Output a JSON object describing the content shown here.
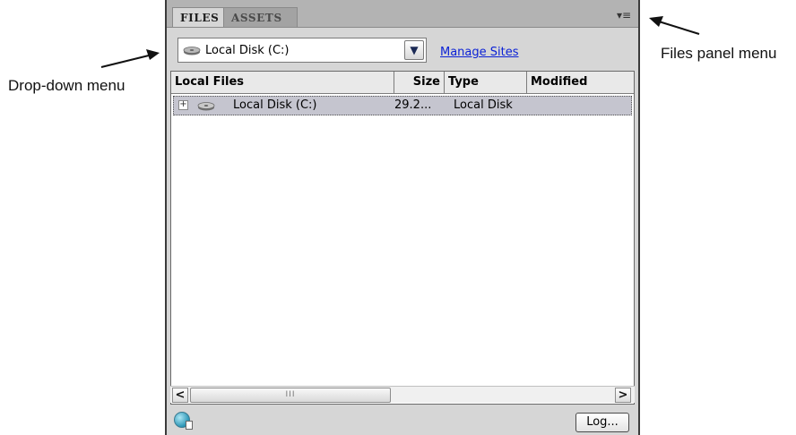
{
  "annotations": {
    "dropdown_label": "Drop-down menu",
    "files_panel_label": "Files panel menu"
  },
  "panel": {
    "tabs": [
      {
        "label": "FILES",
        "active": true
      },
      {
        "label": "ASSETS",
        "active": false
      }
    ],
    "menu_icon": "panel-options-icon",
    "site_selector": {
      "value": "Local Disk (C:)",
      "icon": "hard-disk-icon"
    },
    "manage_sites_link": "Manage Sites",
    "columns": [
      "Local Files",
      "Size",
      "Type",
      "Modified"
    ],
    "rows": [
      {
        "name": "Local Disk (C:)",
        "size": "29.2...",
        "type": "Local Disk",
        "modified": "",
        "expand": "+",
        "selected": true
      }
    ],
    "scrollbar": {
      "left": "<",
      "right": ">",
      "grip": "III"
    },
    "log_button": "Log..."
  },
  "colors": {
    "panel_bg": "#d6d6d6",
    "link": "#0b21d6",
    "selected_row": "#c5c5cf"
  }
}
